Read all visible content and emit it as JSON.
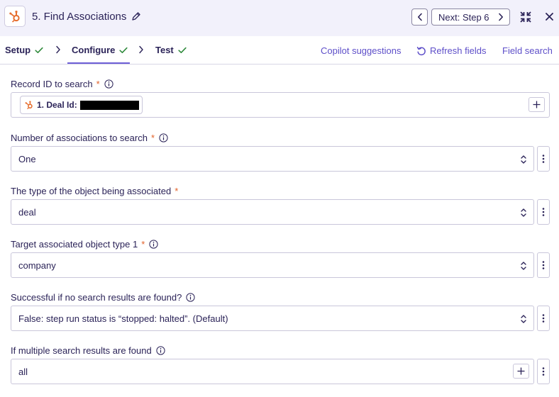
{
  "header": {
    "title": "5. Find Associations",
    "next_label": "Next: Step 6",
    "accent": "#6d5fd6",
    "logo_color": "#e66e2f"
  },
  "tabs": [
    {
      "label": "Setup",
      "done": true
    },
    {
      "label": "Configure",
      "done": true,
      "active": true
    },
    {
      "label": "Test",
      "done": true
    }
  ],
  "actions": {
    "copilot": "Copilot suggestions",
    "refresh": "Refresh fields",
    "field_search": "Field search"
  },
  "fields": {
    "record_id": {
      "label": "Record ID to search",
      "required": "*",
      "pill_label": "1. Deal Id:"
    },
    "num_assoc": {
      "label": "Number of associations to search",
      "required": "*",
      "value": "One"
    },
    "object_type": {
      "label": "The type of the object being associated",
      "required": "*",
      "value": "deal"
    },
    "target_type": {
      "label": "Target associated object type 1",
      "required": "*",
      "value": "company"
    },
    "no_results": {
      "label": "Successful if no search results are found?",
      "value": "False: step run status is “stopped: halted”. (Default)"
    },
    "multiple_results": {
      "label": "If multiple search results are found",
      "value": "all"
    }
  },
  "icons": {
    "success_check": "#2f8a3b",
    "link_color": "#5e4fc9",
    "required_color": "#e2622a"
  }
}
